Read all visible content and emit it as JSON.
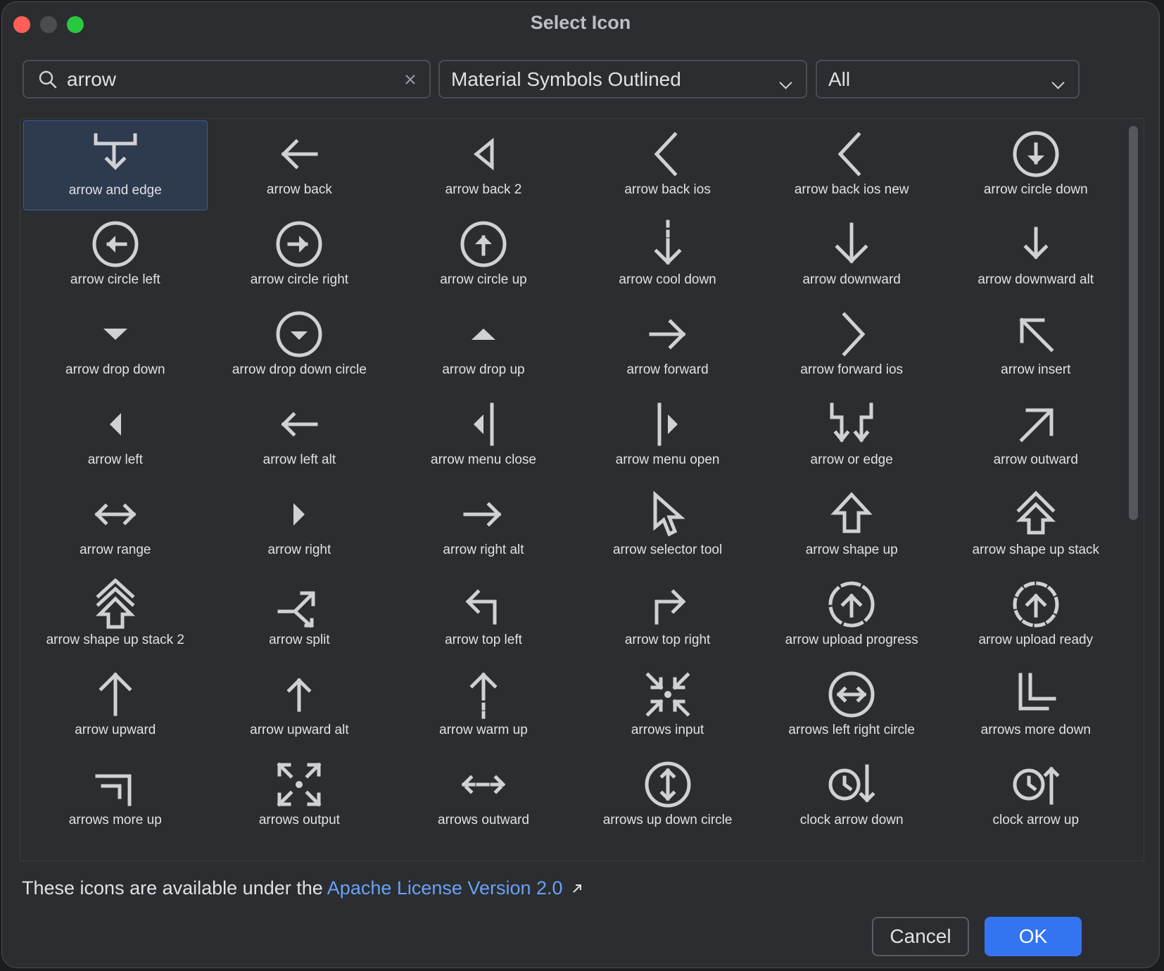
{
  "window": {
    "title": "Select Icon"
  },
  "search": {
    "value": "arrow"
  },
  "icon_set_select": {
    "value": "Material Symbols Outlined"
  },
  "category_select": {
    "value": "All"
  },
  "icons": [
    {
      "label": "arrow and edge",
      "icon": "arrow-and-edge"
    },
    {
      "label": "arrow back",
      "icon": "arrow-back"
    },
    {
      "label": "arrow back 2",
      "icon": "arrow-back-2"
    },
    {
      "label": "arrow back ios",
      "icon": "arrow-back-ios"
    },
    {
      "label": "arrow back ios new",
      "icon": "arrow-back-ios-new"
    },
    {
      "label": "arrow circle down",
      "icon": "arrow-circle-down"
    },
    {
      "label": "arrow circle left",
      "icon": "arrow-circle-left"
    },
    {
      "label": "arrow circle right",
      "icon": "arrow-circle-right"
    },
    {
      "label": "arrow circle up",
      "icon": "arrow-circle-up"
    },
    {
      "label": "arrow cool down",
      "icon": "arrow-cool-down"
    },
    {
      "label": "arrow downward",
      "icon": "arrow-downward"
    },
    {
      "label": "arrow downward alt",
      "icon": "arrow-downward-alt"
    },
    {
      "label": "arrow drop down",
      "icon": "arrow-drop-down"
    },
    {
      "label": "arrow drop down circle",
      "icon": "arrow-drop-down-circle"
    },
    {
      "label": "arrow drop up",
      "icon": "arrow-drop-up"
    },
    {
      "label": "arrow forward",
      "icon": "arrow-forward"
    },
    {
      "label": "arrow forward ios",
      "icon": "arrow-forward-ios"
    },
    {
      "label": "arrow insert",
      "icon": "arrow-insert"
    },
    {
      "label": "arrow left",
      "icon": "arrow-left"
    },
    {
      "label": "arrow left alt",
      "icon": "arrow-left-alt"
    },
    {
      "label": "arrow menu close",
      "icon": "arrow-menu-close"
    },
    {
      "label": "arrow menu open",
      "icon": "arrow-menu-open"
    },
    {
      "label": "arrow or edge",
      "icon": "arrow-or-edge"
    },
    {
      "label": "arrow outward",
      "icon": "arrow-outward"
    },
    {
      "label": "arrow range",
      "icon": "arrow-range"
    },
    {
      "label": "arrow right",
      "icon": "arrow-right"
    },
    {
      "label": "arrow right alt",
      "icon": "arrow-right-alt"
    },
    {
      "label": "arrow selector tool",
      "icon": "arrow-selector-tool"
    },
    {
      "label": "arrow shape up",
      "icon": "arrow-shape-up"
    },
    {
      "label": "arrow shape up stack",
      "icon": "arrow-shape-up-stack"
    },
    {
      "label": "arrow shape up stack 2",
      "icon": "arrow-shape-up-stack-2"
    },
    {
      "label": "arrow split",
      "icon": "arrow-split"
    },
    {
      "label": "arrow top left",
      "icon": "arrow-top-left"
    },
    {
      "label": "arrow top right",
      "icon": "arrow-top-right"
    },
    {
      "label": "arrow upload progress",
      "icon": "arrow-upload-progress"
    },
    {
      "label": "arrow upload ready",
      "icon": "arrow-upload-ready"
    },
    {
      "label": "arrow upward",
      "icon": "arrow-upward"
    },
    {
      "label": "arrow upward alt",
      "icon": "arrow-upward-alt"
    },
    {
      "label": "arrow warm up",
      "icon": "arrow-warm-up"
    },
    {
      "label": "arrows input",
      "icon": "arrows-input"
    },
    {
      "label": "arrows left right circle",
      "icon": "arrows-left-right-circle"
    },
    {
      "label": "arrows more down",
      "icon": "arrows-more-down"
    },
    {
      "label": "arrows more up",
      "icon": "arrows-more-up"
    },
    {
      "label": "arrows output",
      "icon": "arrows-output"
    },
    {
      "label": "arrows outward",
      "icon": "arrows-outward"
    },
    {
      "label": "arrows up down circle",
      "icon": "arrows-up-down-circle"
    },
    {
      "label": "clock arrow down",
      "icon": "clock-arrow-down"
    },
    {
      "label": "clock arrow up",
      "icon": "clock-arrow-up"
    },
    {
      "label": "",
      "icon": "partial-arrow-left"
    },
    {
      "label": "",
      "icon": "partial-box"
    },
    {
      "label": "",
      "icon": "partial-double-chevron"
    },
    {
      "label": "",
      "icon": "partial-arrow"
    },
    {
      "label": "",
      "icon": "partial-arrow-up"
    },
    {
      "label": "",
      "icon": "partial-funnel"
    }
  ],
  "footer": {
    "license_prefix": "These icons are available under the",
    "license_link": "Apache License Version 2.0",
    "license_link_icon": "external-link-icon",
    "cancel_label": "Cancel",
    "ok_label": "OK"
  },
  "colors": {
    "accent": "#3574f0",
    "link": "#6aa1f7",
    "selection": "#2e3a4e"
  }
}
